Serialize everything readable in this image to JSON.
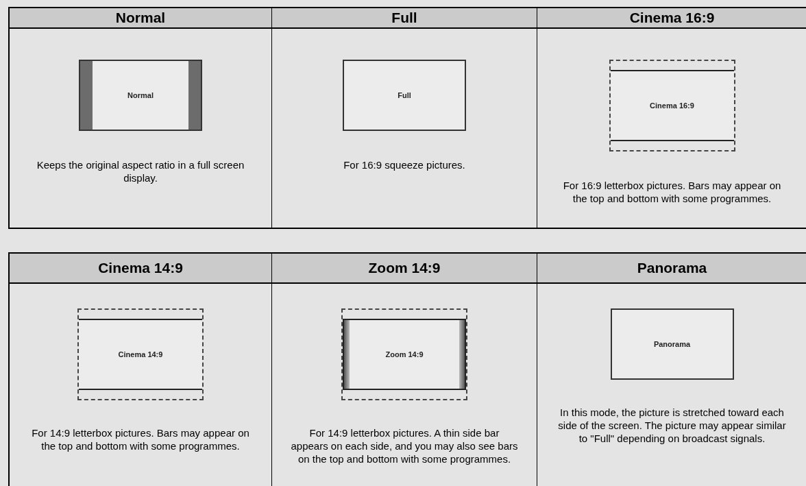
{
  "tables": [
    {
      "cells": [
        {
          "heading": "Normal",
          "kind": "pillarbox",
          "screen_label": "Normal",
          "description": "Keeps the original aspect ratio in a full screen display."
        },
        {
          "heading": "Full",
          "kind": "plain",
          "screen_label": "Full",
          "description": "For 16:9 squeeze pictures."
        },
        {
          "heading": "Cinema 16:9",
          "kind": "letterbox",
          "screen_label": "Cinema 16:9",
          "description": "For 16:9 letterbox pictures. Bars may appear on the top and bottom with some programmes."
        }
      ]
    },
    {
      "cells": [
        {
          "heading": "Cinema 14:9",
          "kind": "letterbox",
          "screen_label": "Cinema 14:9",
          "description": "For 14:9 letterbox pictures. Bars may appear on the top and bottom with some programmes."
        },
        {
          "heading": "Zoom 14:9",
          "kind": "letterbox-sidebars",
          "screen_label": "Zoom 14:9",
          "description": "For 14:9 letterbox pictures. A thin side bar appears on each side, and you may also see bars on the top and bottom with some programmes."
        },
        {
          "heading": "Panorama",
          "kind": "plain",
          "screen_label": "Panorama",
          "description": "In this mode, the picture is stretched toward each side of the screen. The picture may appear similar to \"Full\" depending on broadcast signals."
        }
      ]
    }
  ]
}
